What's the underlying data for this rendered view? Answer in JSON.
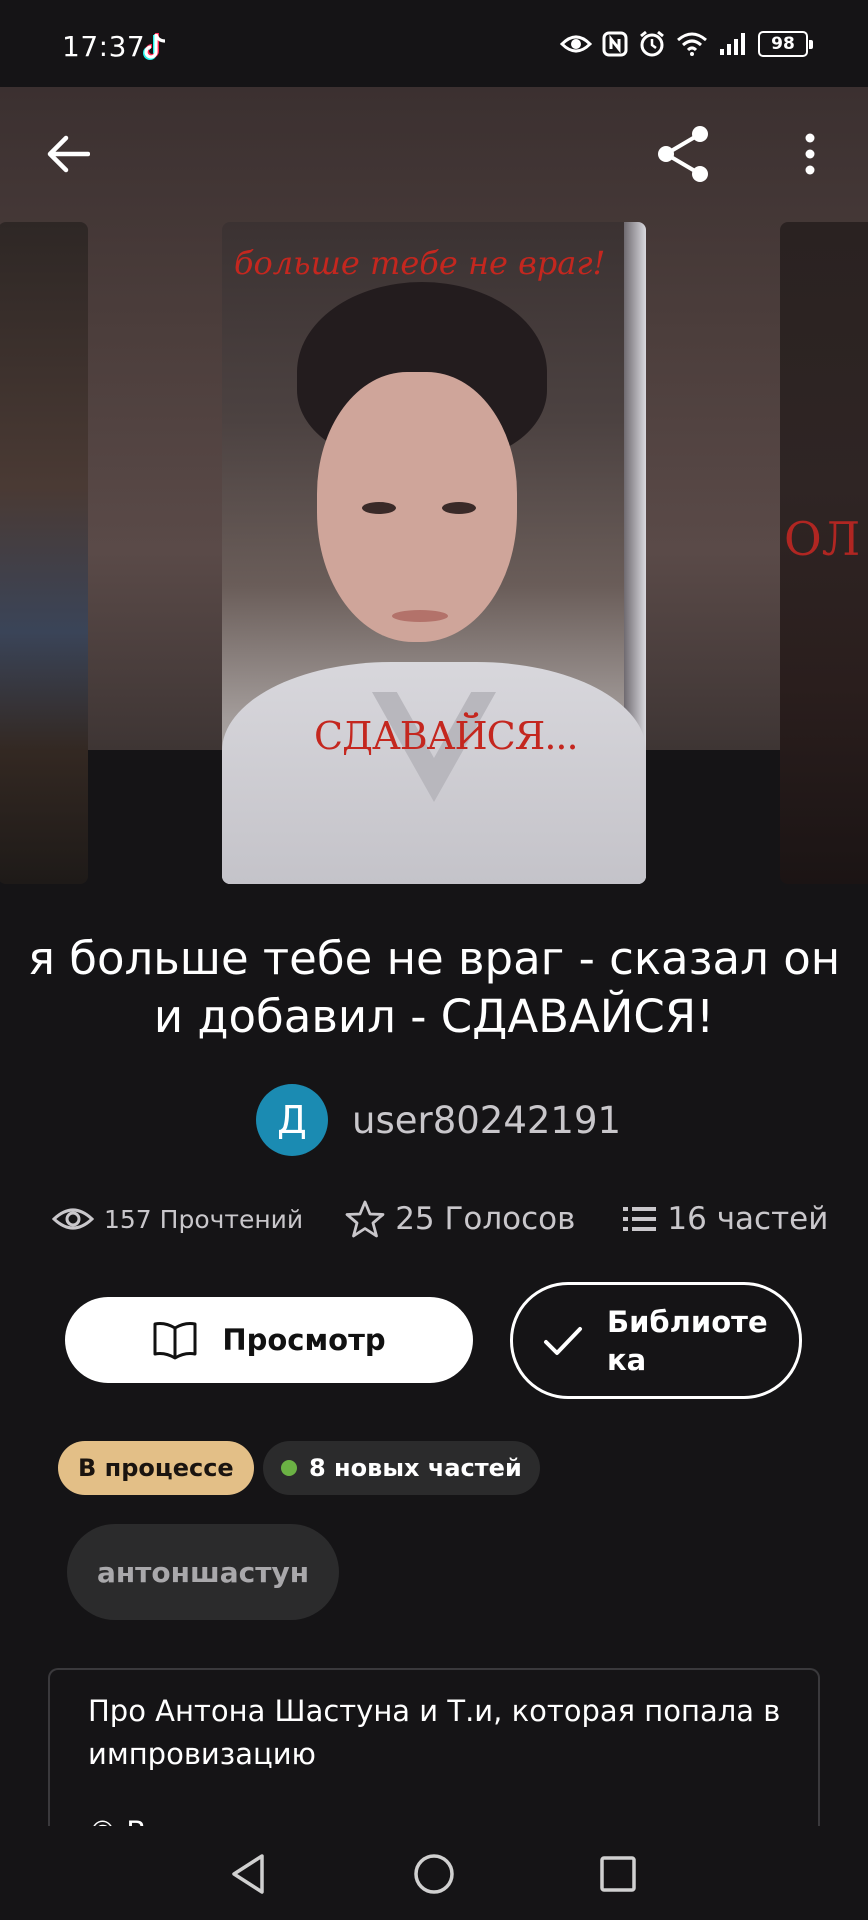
{
  "status_bar": {
    "time": "17:37",
    "battery": "98",
    "icons": [
      "tiktok-icon",
      "eye-icon",
      "nfc-icon",
      "alarm-icon",
      "wifi-icon",
      "signal-icon",
      "battery-icon"
    ]
  },
  "toolbar": {
    "icons": [
      "back-arrow-icon",
      "share-icon",
      "more-vert-icon"
    ]
  },
  "cover": {
    "top_text": "больше тебе не враг!",
    "bottom_text": "СДАВАЙСЯ...",
    "side_right_text": "ОЛ"
  },
  "story": {
    "title": "я больше тебе не враг - сказал он и добавил - СДАВАЙСЯ!",
    "author": {
      "initial": "Д",
      "name": "user80242191",
      "avatar_color": "#1b8bb2"
    },
    "stats": {
      "reads": "157 Прочтений",
      "votes": "25 Голосов",
      "parts": "16 частей"
    }
  },
  "actions": {
    "preview_label": "Просмотр",
    "library_label": "Библиотека"
  },
  "badges": {
    "status": "В процессе",
    "status_color": "#e3bf87",
    "new_parts": "8 новых частей",
    "new_dot_color": "#6bb144"
  },
  "tags": [
    "антоншастун"
  ],
  "description": {
    "text": "Про Антона Шастуна и Т.и, которая попала в импровизацию",
    "partial_line": "© В"
  },
  "nav_bar": {
    "icons": [
      "back-triangle-icon",
      "home-circle-icon",
      "recents-square-icon"
    ]
  }
}
